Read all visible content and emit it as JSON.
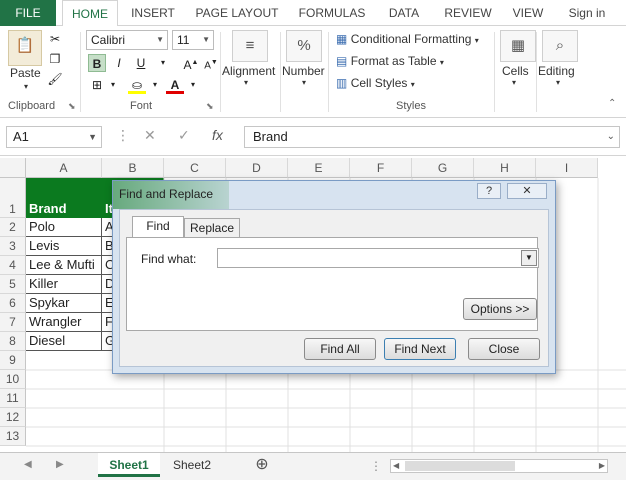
{
  "ribbon_tabs": [
    {
      "label": "FILE"
    },
    {
      "label": "HOME"
    },
    {
      "label": "INSERT"
    },
    {
      "label": "PAGE LAYOUT"
    },
    {
      "label": "FORMULAS"
    },
    {
      "label": "DATA"
    },
    {
      "label": "REVIEW"
    },
    {
      "label": "VIEW"
    },
    {
      "label": "Sign in"
    }
  ],
  "clipboard": {
    "paste_label": "Paste",
    "group_label": "Clipboard"
  },
  "font": {
    "name": "Calibri",
    "size": "11",
    "bold_label": "B",
    "italic_label": "I",
    "underline_label": "U",
    "group_label": "Font"
  },
  "alignment": {
    "label": "Alignment"
  },
  "number": {
    "label": "Number"
  },
  "styles": {
    "conditional_formatting": "Conditional Formatting",
    "format_as_table": "Format as Table",
    "cell_styles": "Cell Styles",
    "group_label": "Styles"
  },
  "cells": {
    "label": "Cells"
  },
  "editing": {
    "label": "Editing"
  },
  "formula_bar": {
    "name_box": "A1",
    "fx_label": "fx",
    "value": "Brand"
  },
  "columns": [
    "A",
    "B",
    "C",
    "D",
    "E",
    "F",
    "G",
    "H",
    "I"
  ],
  "rows": [
    "1",
    "2",
    "3",
    "4",
    "5",
    "6",
    "7",
    "8",
    "9",
    "10",
    "11",
    "12",
    "13"
  ],
  "cells_data": {
    "col_a": [
      "Brand",
      "Polo",
      "Levis",
      "Lee & Mufti",
      "Killer",
      "Spykar",
      "Wrangler",
      "Diesel"
    ],
    "col_b": [
      "It",
      "A",
      "B",
      "C",
      "D",
      "E",
      "F",
      "G"
    ]
  },
  "sheets": [
    {
      "label": "Sheet1"
    },
    {
      "label": "Sheet2"
    }
  ],
  "dialog": {
    "title": "Find and Replace",
    "help_label": "?",
    "close_glyph": "✕",
    "tabs": [
      {
        "label": "Find"
      },
      {
        "label": "Replace"
      }
    ],
    "find_what_label": "Find what:",
    "find_what_value": "",
    "options_button": "Options >>",
    "find_all_button": "Find All",
    "find_next_button": "Find Next",
    "close_button": "Close"
  },
  "colors": {
    "excel_green": "#217346",
    "header_fill": "#0b7a1f"
  }
}
